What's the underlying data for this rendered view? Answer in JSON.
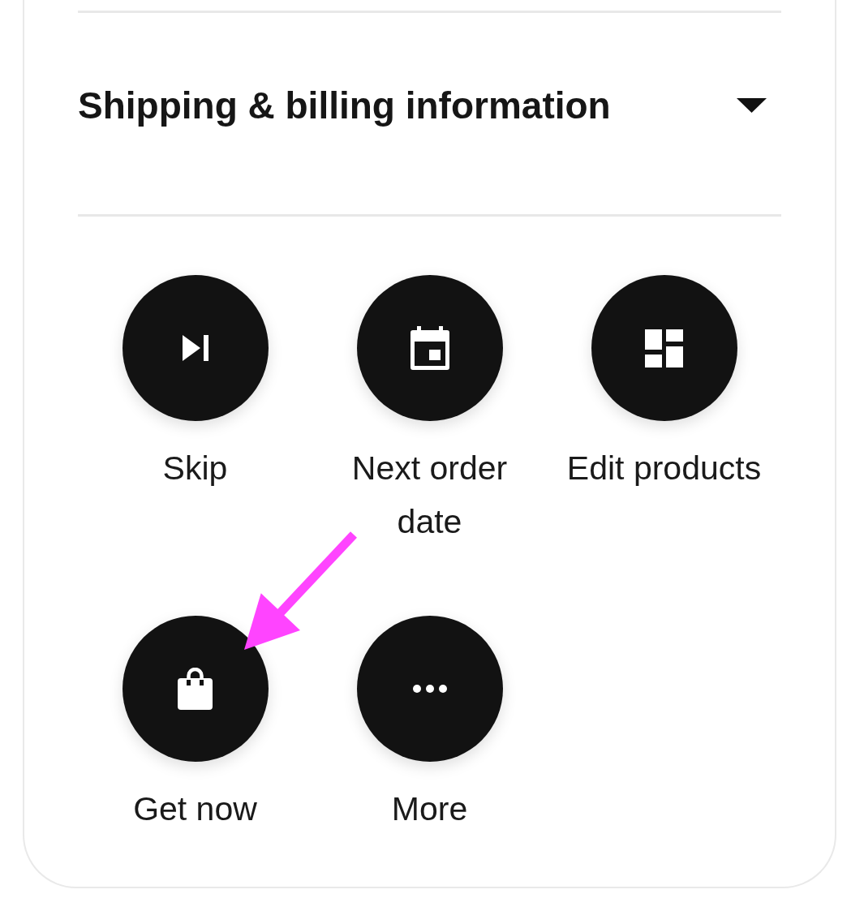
{
  "section": {
    "title": "Shipping & billing information",
    "expanded": false
  },
  "actions": [
    {
      "kind": "skip",
      "label": "Skip",
      "annotated": false
    },
    {
      "kind": "date",
      "label": "Next order date",
      "annotated": false
    },
    {
      "kind": "edit",
      "label": "Edit products",
      "annotated": false
    },
    {
      "kind": "buy",
      "label": "Get now",
      "annotated": true
    },
    {
      "kind": "more",
      "label": "More",
      "annotated": false
    }
  ]
}
